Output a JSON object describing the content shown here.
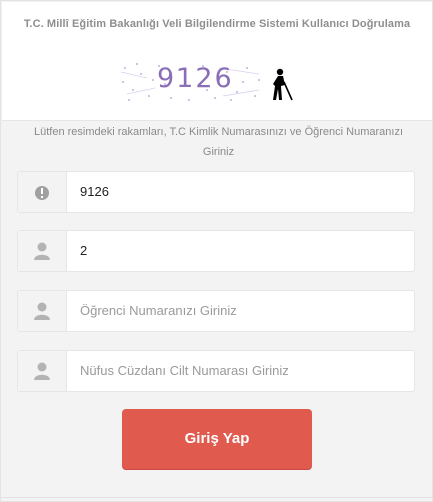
{
  "header": {
    "title": "T.C. Millî Eğitim Bakanlığı  Veli Bilgilendirme Sistemi Kullanıcı Doğrulama"
  },
  "captcha": {
    "text": "9126"
  },
  "hint": "Lütfen resimdeki rakamları, T.C Kimlik Numarasınızı ve Öğrenci Numaranızı Giriniz",
  "fields": {
    "captcha_value": "9126",
    "tc_value": "2",
    "student_placeholder": "Öğrenci Numaranızı Giriniz",
    "cilt_placeholder": "Nüfus Cüzdanı Cilt  Numarası Giriniz"
  },
  "button": {
    "label": "Giriş Yap"
  },
  "icons": {
    "field1": "info-circle-icon",
    "field2": "user-icon",
    "field3": "user-icon",
    "field4": "user-icon",
    "accessibility": "blind-person-icon"
  },
  "colors": {
    "button": "#e05a4e",
    "captcha_text": "#8a6fb8"
  }
}
